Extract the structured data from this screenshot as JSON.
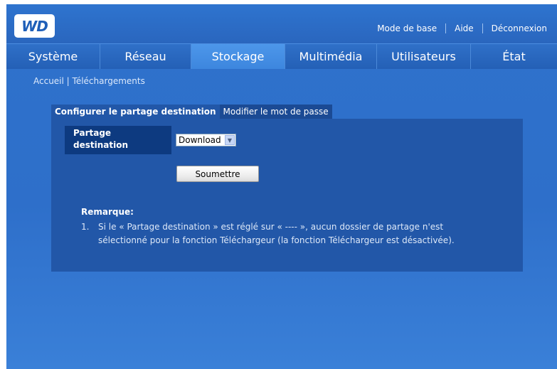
{
  "brand": {
    "logo_text": "WD"
  },
  "toplinks": [
    "Mode de base",
    "Aide",
    "Déconnexion"
  ],
  "nav": {
    "tabs": [
      {
        "label": "Système",
        "active": false
      },
      {
        "label": "Réseau",
        "active": false
      },
      {
        "label": "Stockage",
        "active": true
      },
      {
        "label": "Multimédia",
        "active": false
      },
      {
        "label": "Utilisateurs",
        "active": false
      },
      {
        "label": "État",
        "active": false
      }
    ]
  },
  "breadcrumb": {
    "home": "Accueil",
    "separator": " | ",
    "current": "Téléchargements"
  },
  "panel": {
    "tabs": [
      {
        "label": "Configurer le partage destination",
        "active": true
      },
      {
        "label": "Modifier le mot de passe",
        "active": false
      }
    ],
    "share_label": "Partage destination",
    "share_value": "Download",
    "submit_label": "Soumettre",
    "note_title": "Remarque:",
    "note_number": "1.",
    "note_line1": "Si le « Partage destination » est réglé sur « ---- », aucun dossier de partage n'est",
    "note_line2": "sélectionné pour la fonction Téléchargeur (la fonction Téléchargeur est désactivée)."
  },
  "colors": {
    "accent": "#2e6fca",
    "active_tab": "#3d86de",
    "panel": "#2257a8"
  }
}
